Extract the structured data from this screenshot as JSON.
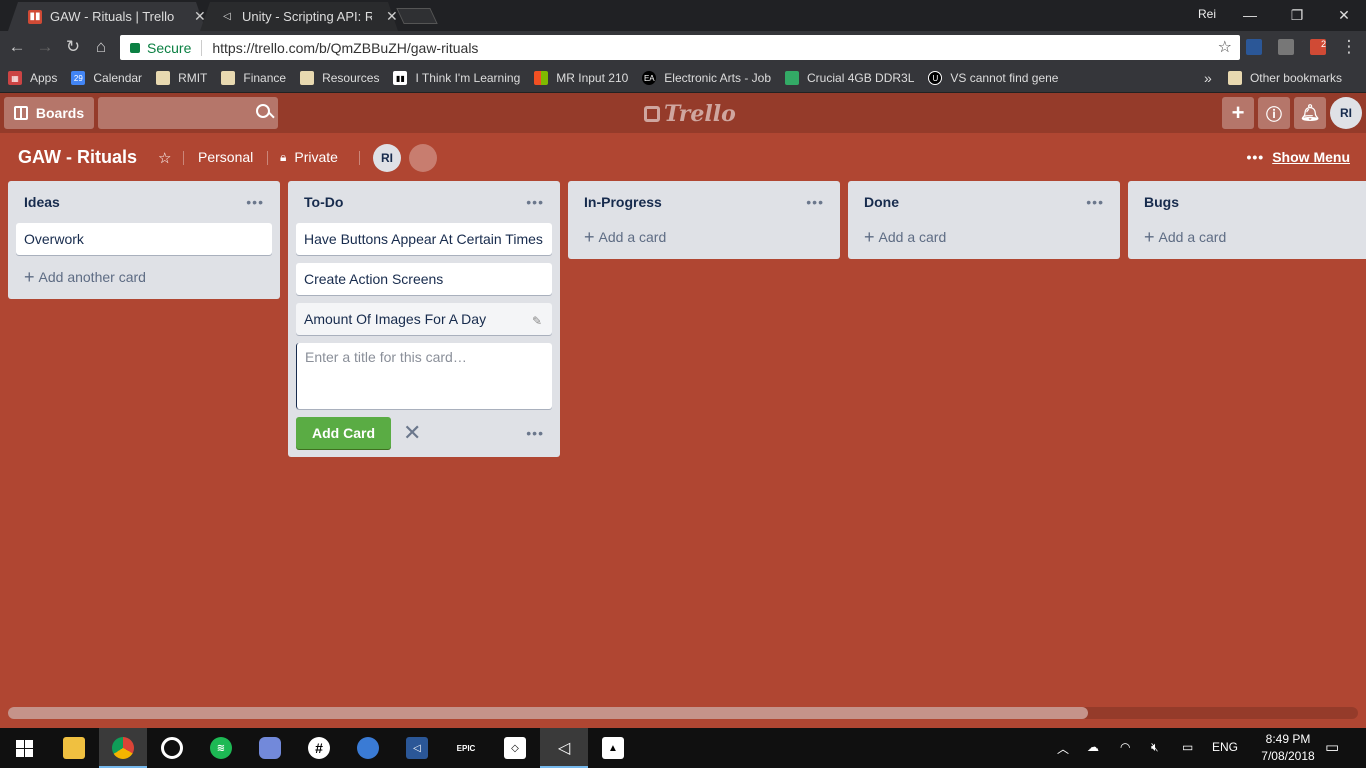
{
  "browser": {
    "tabs": [
      {
        "title": "GAW - Rituals | Trello",
        "active": true
      },
      {
        "title": "Unity - Scripting API: Res",
        "active": false
      }
    ],
    "profile": "Rei",
    "address": {
      "secure_label": "Secure",
      "url": "https://trello.com/b/QmZBBuZH/gaw-rituals"
    },
    "extension_badge": "2",
    "bookmarks": [
      {
        "label": "Apps",
        "icon": "apps-icon"
      },
      {
        "label": "Calendar",
        "icon": "calendar-icon",
        "icon_text": "29"
      },
      {
        "label": "RMIT",
        "icon": "bookmark-page-icon"
      },
      {
        "label": "Finance",
        "icon": "bookmark-page-icon"
      },
      {
        "label": "Resources",
        "icon": "bookmark-page-icon"
      },
      {
        "label": "I Think I'm Learning",
        "icon": "bookmark-page-icon"
      },
      {
        "label": "MR Input 210",
        "icon": "windows-logo-icon"
      },
      {
        "label": "Electronic Arts - Job",
        "icon": "ea-icon"
      },
      {
        "label": "Crucial 4GB DDR3L",
        "icon": "crucial-icon"
      },
      {
        "label": "VS cannot find gene",
        "icon": "unreal-icon"
      }
    ],
    "bookmarks_more": "»",
    "other_bookmarks": "Other bookmarks"
  },
  "trello": {
    "boards_label": "Boards",
    "logo_text": "Trello",
    "user_initials": "RI",
    "board": {
      "title": "GAW - Rituals",
      "team": "Personal",
      "visibility": "Private",
      "member_initials": "RI",
      "show_menu": "Show Menu"
    },
    "lists": [
      {
        "title": "Ideas",
        "cards": [
          "Overwork"
        ],
        "add_label": "Add another card"
      },
      {
        "title": "To-Do",
        "cards": [
          "Have Buttons Appear At Certain Times",
          "Create Action Screens",
          "Amount Of Images For A Day"
        ],
        "composer": {
          "placeholder": "Enter a title for this card…",
          "add_button": "Add Card"
        }
      },
      {
        "title": "In-Progress",
        "cards": [],
        "add_label": "Add a card"
      },
      {
        "title": "Done",
        "cards": [],
        "add_label": "Add a card"
      },
      {
        "title": "Bugs",
        "cards": [],
        "add_label": "Add a card"
      }
    ],
    "horizontal_scroll_fraction": 0.8
  },
  "taskbar": {
    "apps": [
      {
        "name": "file-explorer-icon"
      },
      {
        "name": "chrome-icon",
        "active": true
      },
      {
        "name": "media-player-icon"
      },
      {
        "name": "spotify-icon"
      },
      {
        "name": "discord-icon"
      },
      {
        "name": "slack-icon"
      },
      {
        "name": "maps-icon"
      },
      {
        "name": "visual-studio-icon"
      },
      {
        "name": "epic-games-icon",
        "label": "EPIC"
      },
      {
        "name": "unity-hub-icon"
      },
      {
        "name": "unity-icon",
        "active": true
      },
      {
        "name": "photos-icon"
      }
    ],
    "language": "ENG",
    "time": "8:49 PM",
    "date": "7/08/2018"
  }
}
